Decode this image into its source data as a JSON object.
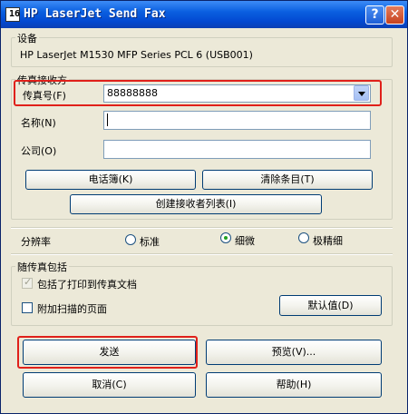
{
  "window": {
    "title": "HP LaserJet Send Fax",
    "app_icon_glyph": "16",
    "help_glyph": "?",
    "close_glyph": "✕"
  },
  "device": {
    "legend": "设备",
    "name": "HP LaserJet M1530 MFP Series PCL 6 (USB001)"
  },
  "recipient": {
    "legend": "传真接收方",
    "fax_label": "传真号(F)",
    "fax_value": "88888888",
    "name_label": "名称(N)",
    "name_value": "",
    "company_label": "公司(O)",
    "company_value": "",
    "phonebook_button": "电话簿(K)",
    "clear_button": "清除条目(T)",
    "create_list_button": "创建接收者列表(I)"
  },
  "resolution": {
    "label": "分辨率",
    "options": [
      "标准",
      "细微",
      "极精细"
    ],
    "selected": "细微"
  },
  "attachments": {
    "legend": "随传真包括",
    "include_printed_label": "包括了打印到传真文档",
    "include_printed_checked": true,
    "scan_pages_label": "附加扫描的页面",
    "scan_pages_checked": false,
    "defaults_button": "默认值(D)"
  },
  "actions": {
    "send": "发送",
    "preview": "预览(V)...",
    "cancel": "取消(C)",
    "help": "帮助(H)"
  },
  "colors": {
    "highlight": "#E0201A",
    "title_bar": "#0A5FE0",
    "dialog_bg": "#ECE9D8"
  }
}
